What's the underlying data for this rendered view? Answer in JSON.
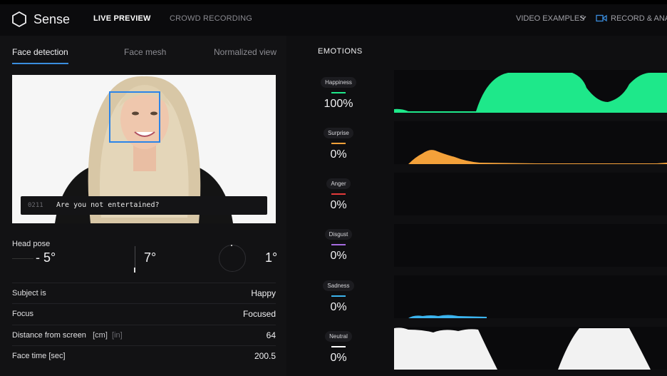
{
  "header": {
    "brand": "Sense",
    "nav": [
      "LIVE PREVIEW",
      "CROWD RECORDING"
    ],
    "video_examples": "VIDEO EXAMPLES",
    "record": "RECORD & ANAL"
  },
  "tabs": [
    "Face detection",
    "Face mesh",
    "Normalized view"
  ],
  "caption": {
    "number": "0211",
    "text": "Are you not entertained?"
  },
  "head_pose": {
    "label": "Head pose",
    "values": [
      "- 5°",
      "7°",
      "1°"
    ]
  },
  "stats": [
    {
      "label": "Subject is",
      "value": "Happy"
    },
    {
      "label": "Focus",
      "value": "Focused"
    },
    {
      "label": "Distance from screen",
      "unit_a": "[cm]",
      "unit_b": "[in]",
      "value": "64"
    },
    {
      "label": "Face time [sec]",
      "value": "200.5"
    }
  ],
  "emotions": {
    "title": "EMOTIONS",
    "items": [
      {
        "name": "Happiness",
        "value": "100%",
        "color": "#1ee88a"
      },
      {
        "name": "Surprise",
        "value": "0%",
        "color": "#f3a13a"
      },
      {
        "name": "Anger",
        "value": "0%",
        "color": "#e43a3a"
      },
      {
        "name": "Disgust",
        "value": "0%",
        "color": "#a66be0"
      },
      {
        "name": "Sadness",
        "value": "0%",
        "color": "#3cb4ee"
      },
      {
        "name": "Neutral",
        "value": "0%",
        "color": "#ffffff"
      }
    ]
  },
  "colors": {
    "accent": "#3a8dde",
    "face_box": "#2b84e8"
  },
  "icons": [
    "hexagon-logo-icon",
    "chevron-down-icon",
    "video-camera-icon"
  ]
}
